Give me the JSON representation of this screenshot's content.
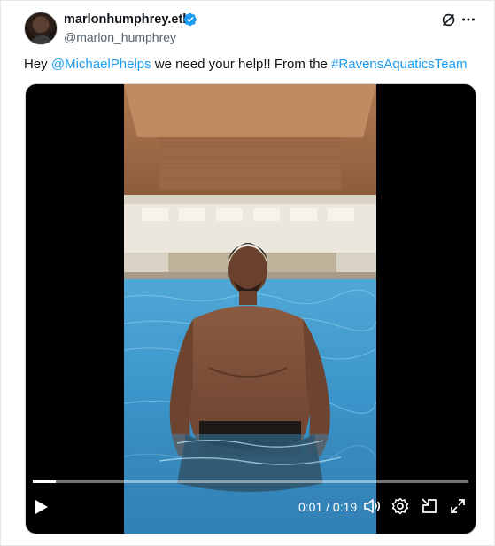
{
  "author": {
    "display_name": "marlonhumphrey.eth",
    "handle": "@marlon_humphrey",
    "verified": true
  },
  "tweet": {
    "text_before": "Hey ",
    "mention": "@MichaelPhelps",
    "text_middle": " we need your help!! From the ",
    "hashtag": "#RavensAquaticsTeam"
  },
  "video": {
    "current_time": "0:01",
    "separator": " / ",
    "duration": "0:19",
    "progress": 0.053
  },
  "icons": {
    "grok": "grok-icon",
    "more": "more-icon",
    "verified": "verified-badge-icon",
    "play": "play-icon",
    "volume": "volume-icon",
    "settings": "settings-icon",
    "pip": "picture-in-picture-icon",
    "fullscreen": "fullscreen-icon"
  },
  "colors": {
    "link": "#1d9bf0",
    "verified": "#1d9bf0",
    "handle": "#536471",
    "text": "#0f1419",
    "video_background": "#000000"
  }
}
